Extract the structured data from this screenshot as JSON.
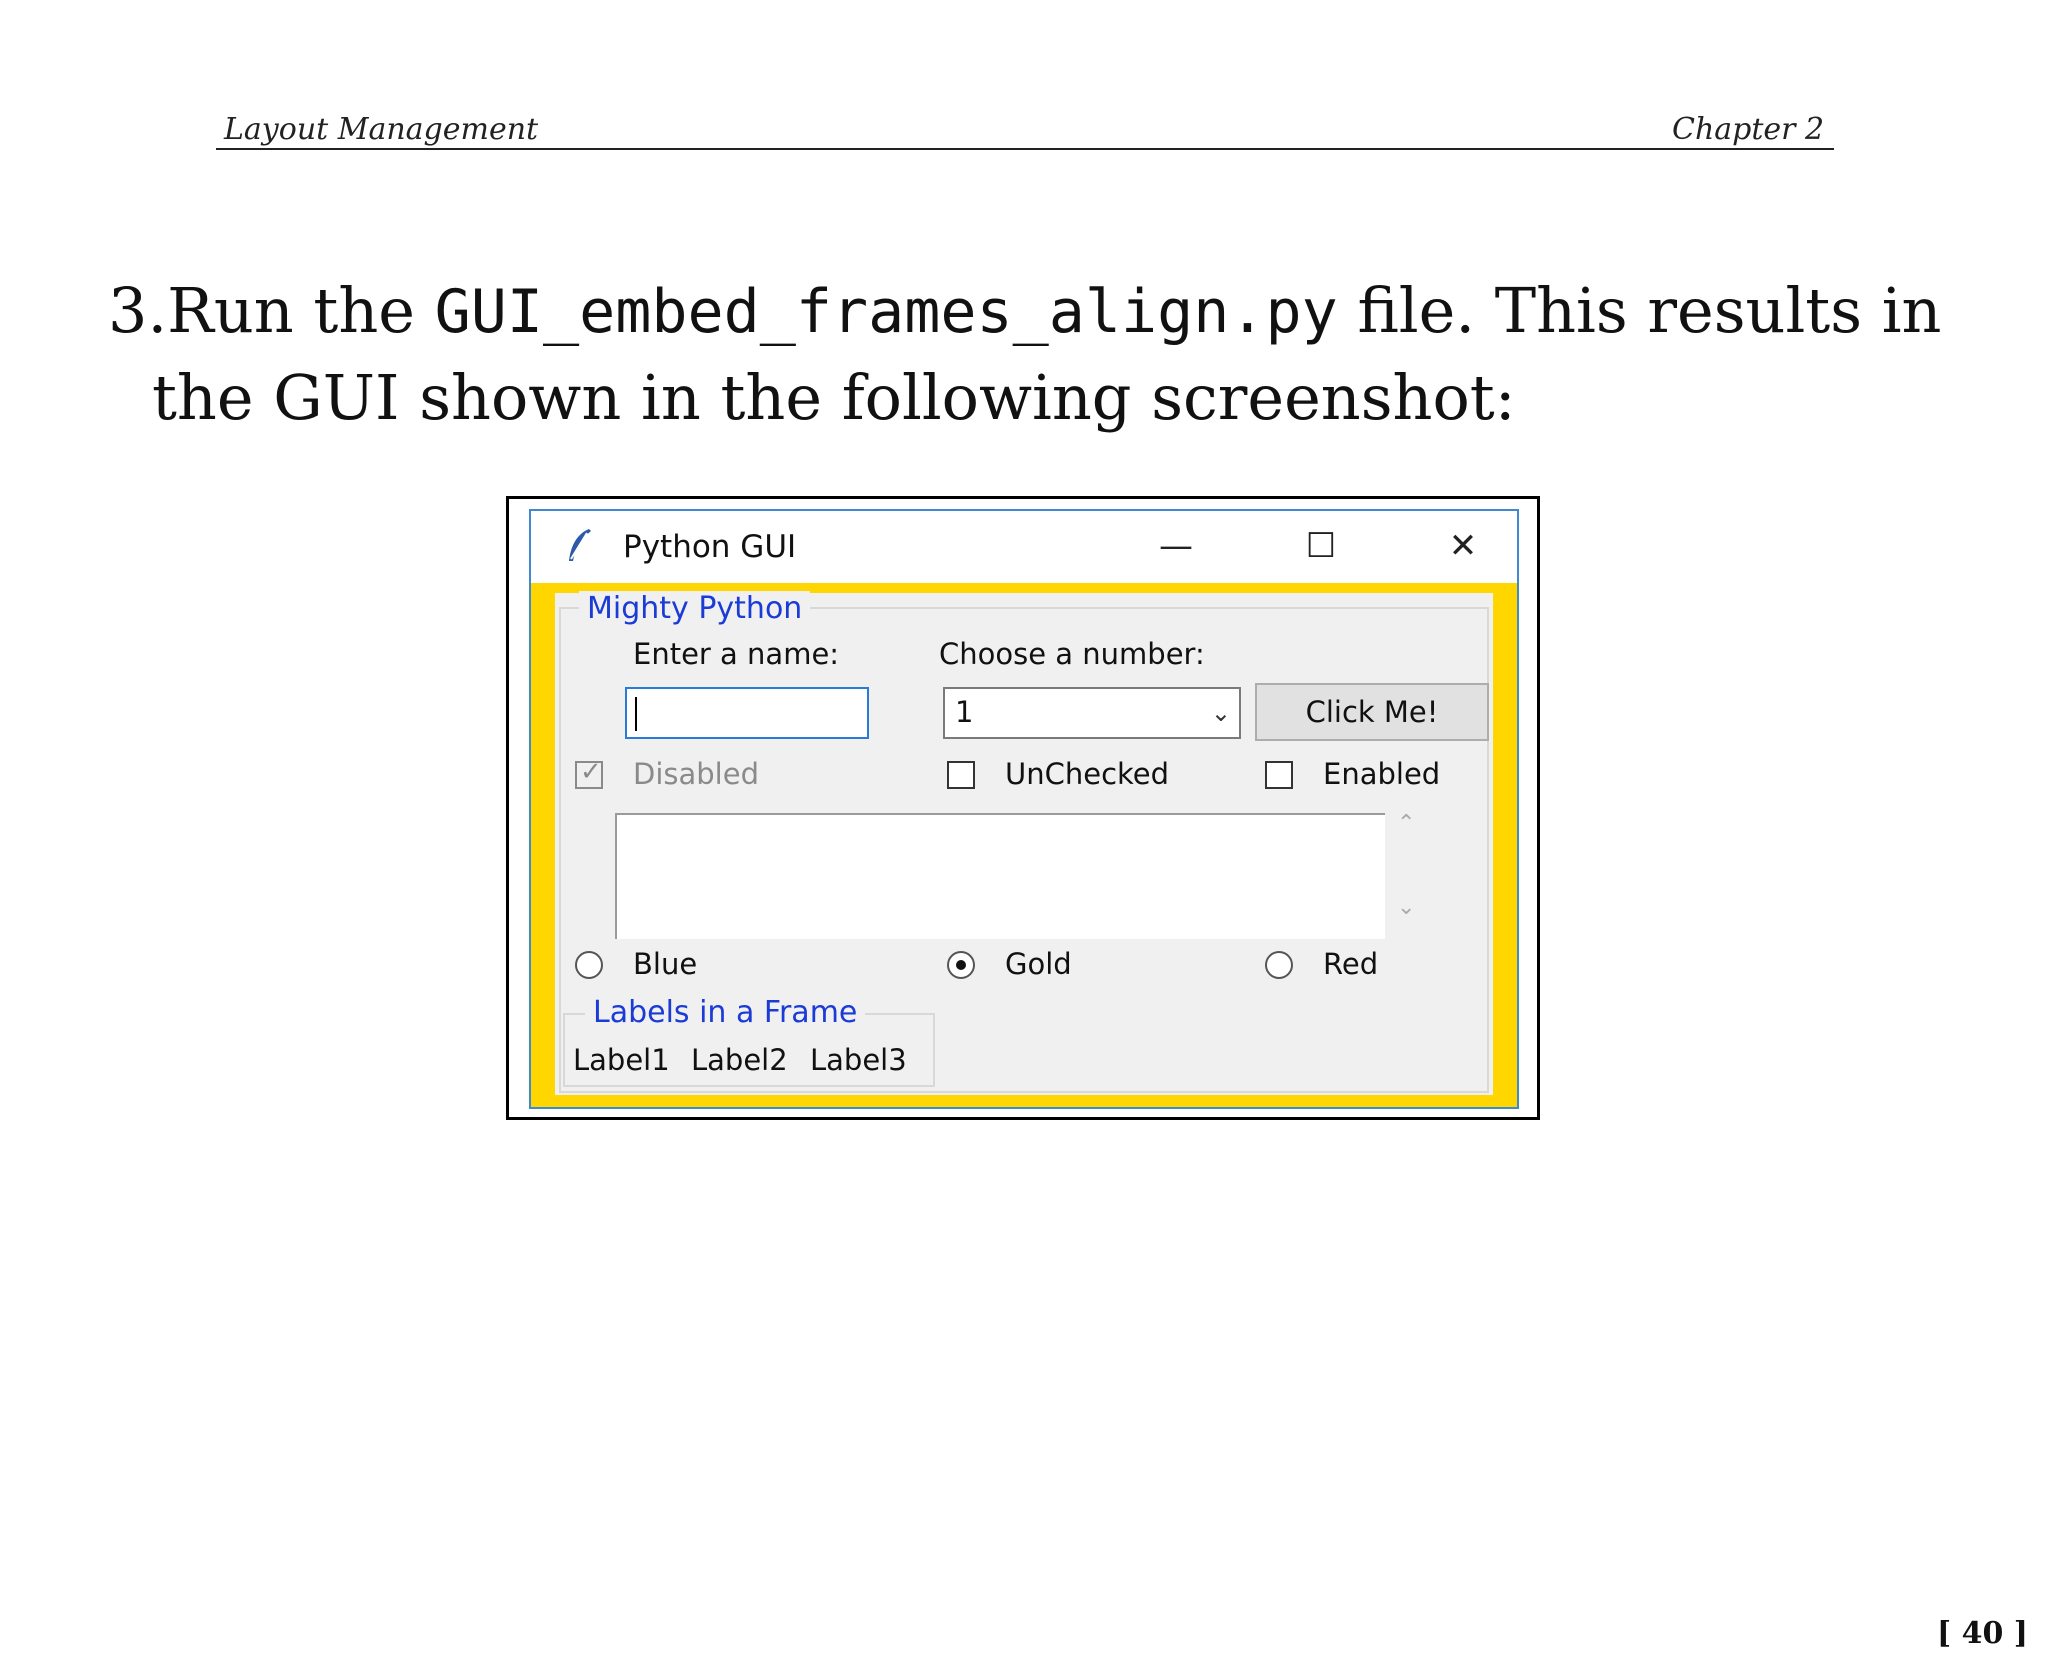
{
  "header": {
    "left": "Layout Management",
    "right": "Chapter 2"
  },
  "step": {
    "prefix": "3.Run the ",
    "code": "GUI_embed_frames_align.py",
    "suffix": " file. This results in",
    "line2": "the GUI shown in  the following screenshot:"
  },
  "window": {
    "title": "Python GUI",
    "icon": "feather-icon",
    "controls": {
      "minimize": "—",
      "maximize": "☐",
      "close": "✕"
    }
  },
  "frame": {
    "title": "Mighty Python",
    "name_label": "Enter a name:",
    "name_value": "",
    "number_label": "Choose a number:",
    "number_value": "1",
    "button_label": "Click Me!",
    "checkboxes": [
      {
        "label": "Disabled",
        "checked": true,
        "enabled": false
      },
      {
        "label": "UnChecked",
        "checked": false,
        "enabled": true
      },
      {
        "label": "Enabled",
        "checked": false,
        "enabled": true
      }
    ],
    "radios": [
      {
        "label": "Blue",
        "selected": false
      },
      {
        "label": "Gold",
        "selected": true
      },
      {
        "label": "Red",
        "selected": false
      }
    ],
    "inner_frame_title": "Labels in a Frame",
    "labels": [
      "Label1",
      "Label2",
      "Label3"
    ]
  },
  "colors": {
    "window_bg": "#ffd600",
    "legend_text": "#1a3bd6",
    "window_border": "#3d8ad1"
  },
  "page_number": "[ 40 ]"
}
